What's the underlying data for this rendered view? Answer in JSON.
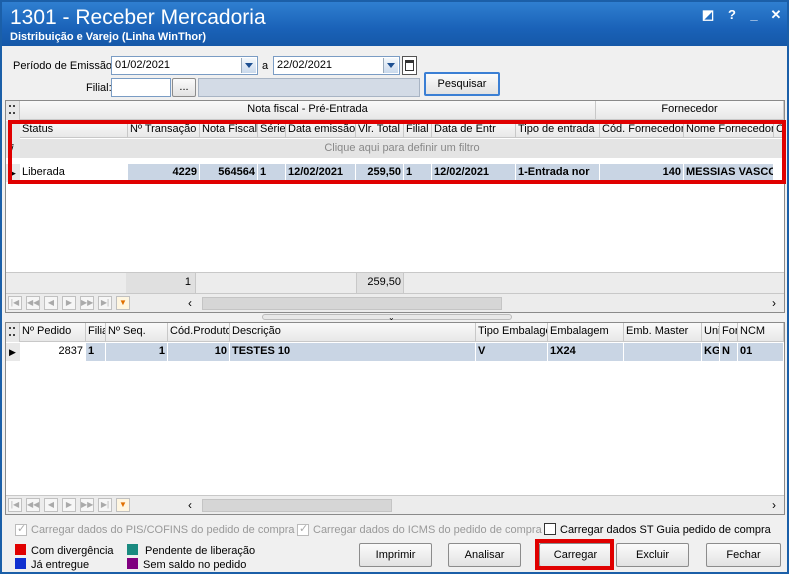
{
  "window": {
    "title": "1301 - Receber Mercadoria",
    "subtitle": "Distribuição e Varejo (Linha WinThor)"
  },
  "filters": {
    "periodo_label": "Período de Emissão:",
    "date_from": "01/02/2021",
    "a_label": "a",
    "date_to": "22/02/2021",
    "filial_label": "Filial:",
    "ellipsis": "...",
    "search_button": "Pesquisar"
  },
  "grid1": {
    "band_nota": "Nota fiscal - Pré-Entrada",
    "band_fornecedor": "Fornecedor",
    "columns": [
      "Status",
      "Nº Transação",
      "Nota Fiscal",
      "Série",
      "Data emissão",
      "Vlr. Total",
      "Filial",
      "Data de Entr",
      "Tipo de entrada",
      "Cód. Fornecedor",
      "Nome Fornecedor",
      "C"
    ],
    "filter_hint": "Clique aqui para definir um filtro",
    "row": [
      "Liberada",
      "4229",
      "564564",
      "1",
      "12/02/2021",
      "259,50",
      "1",
      "12/02/2021",
      "1-Entrada nor",
      "140",
      "MESSIAS VASCO"
    ],
    "footer_count": "1",
    "footer_total": "259,50"
  },
  "grid2": {
    "columns": [
      "Nº Pedido",
      "Filia",
      "Nº Seq.",
      "Cód.Produto",
      "Descrição",
      "Tipo Embalage",
      "Embalagem",
      "Emb. Master",
      "Uni",
      "For",
      "NCM"
    ],
    "row": [
      "2837",
      "1",
      "1",
      "10",
      "TESTES 10",
      "V",
      "1X24",
      "",
      "KG",
      "N",
      "01"
    ]
  },
  "options": {
    "pis_cofins": "Carregar dados do PIS/COFINS do pedido de compra",
    "icms": "Carregar dados do ICMS do pedido de compra",
    "st_guia": "Carregar dados ST Guia pedido de compra"
  },
  "legend": [
    {
      "label": "Com divergência",
      "color": "#e00000"
    },
    {
      "label": "Pendente de liberação",
      "color": "#1a8a80"
    },
    {
      "label": "Já entregue",
      "color": "#1030d0"
    },
    {
      "label": "Sem saldo no pedido",
      "color": "#800080"
    }
  ],
  "buttons": {
    "imprimir": "Imprimir",
    "analisar": "Analisar",
    "carregar": "Carregar",
    "excluir": "Excluir",
    "fechar": "Fechar"
  }
}
